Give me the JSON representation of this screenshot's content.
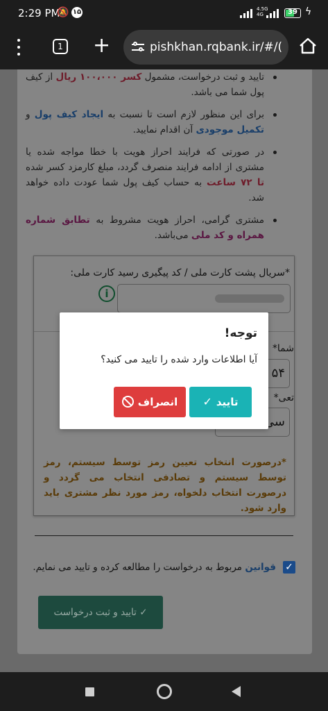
{
  "status_bar": {
    "time": "2:29 PM",
    "notification_count": "۱۵",
    "network_label_top": "4.5G",
    "network_label_bottom": "4G",
    "battery_level": "39"
  },
  "browser": {
    "tab_count": "1",
    "url": "pishkhan.rqbank.ir/#/("
  },
  "info_bullets": [
    {
      "pre": "تایید و ثبت درخواست، مشمول ",
      "em": "کسر ۱۰۰،۰۰۰ ریال",
      "post": " از کیف پول شما می باشد."
    },
    {
      "pre": "برای این منظور لازم است تا نسبت به ",
      "em1": "ایجاد کیف پول",
      "mid": " و ",
      "em2": "تکمیل موجودی",
      "post": " آن اقدام نمایید."
    },
    {
      "pre": "در صورتی که فرایند احراز هویت با خطا مواجه شده یا مشتری از ادامه فرایند منصرف گردد، مبلغ کارمزد کسر شده ",
      "em": "تا ۷۲ ساعت",
      "post": " به حساب کیف پول شما عودت داده خواهد شد."
    },
    {
      "pre": "مشتری گرامی، احراز هویت مشروط به ",
      "em": "تطابق شماره همراه و کد ملی",
      "post": " می‌باشد."
    }
  ],
  "form": {
    "serial_label": "*سریال پشت کارت ملی / کد پیگیری رسید کارت ملی:",
    "mobile_label": "*شما",
    "mobile_value": "۵۴",
    "password_label": "*تعی",
    "password_value": "سی",
    "note": "*درصورت انتخاب تعیین رمز توسط سیستم، رمز توسط سیستم و تصادفی انتخاب می گردد و درصورت انتخاب دلخواه، رمز مورد نظر مشتری باید وارد شود."
  },
  "rules": {
    "link": "قوانین",
    "text": " مربوط به درخواست را مطالعه کرده و تایید می نمایم."
  },
  "submit_label": "تایید و ثبت درخواست",
  "modal": {
    "title": "توجه!",
    "message": "آیا اطلاعات وارد شده را تایید می کنید؟",
    "confirm_label": "تایید",
    "cancel_label": "انصراف"
  }
}
